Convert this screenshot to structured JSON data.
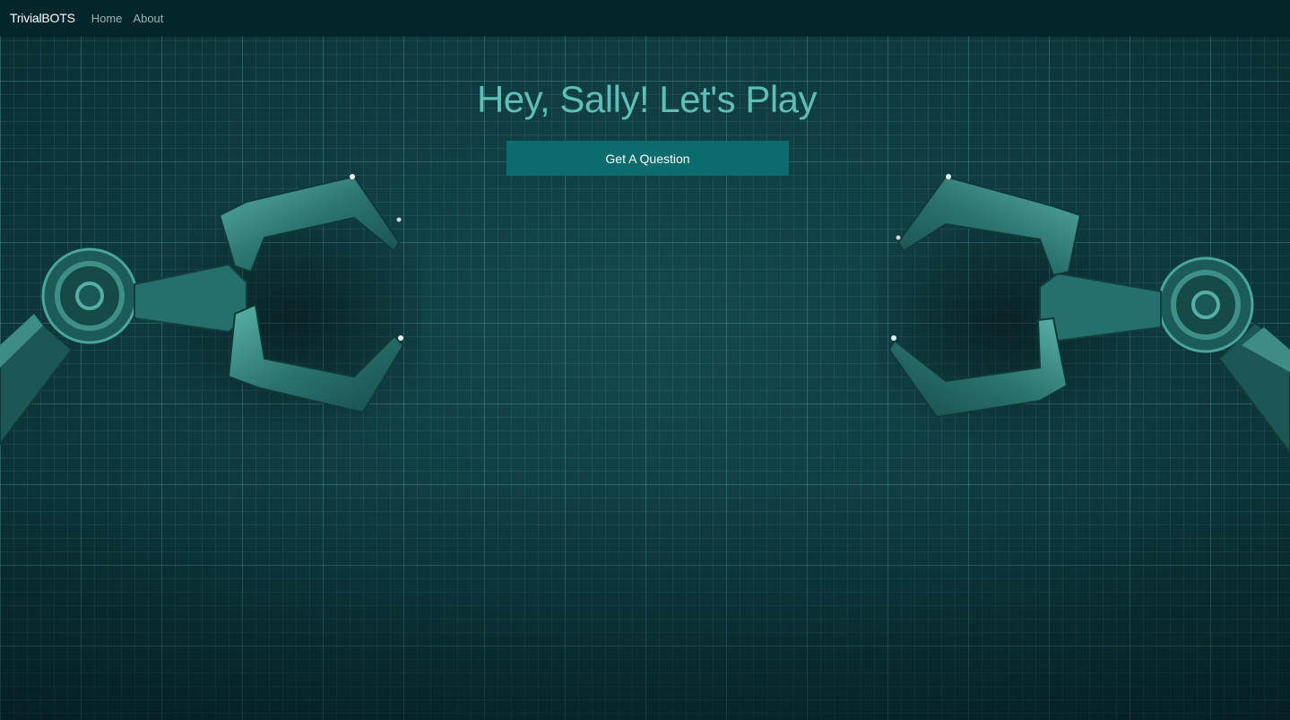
{
  "nav": {
    "brand": "TrivialBOTS",
    "links": [
      "Home",
      "About"
    ]
  },
  "main": {
    "headline": "Hey, Sally! Let's Play",
    "button_label": "Get A Question"
  },
  "colors": {
    "navbar": "#03262a",
    "background": "#0e3a3f",
    "headline": "#5fbfb8",
    "button": "#0b6b6d",
    "claw": "#2f7f7a"
  }
}
